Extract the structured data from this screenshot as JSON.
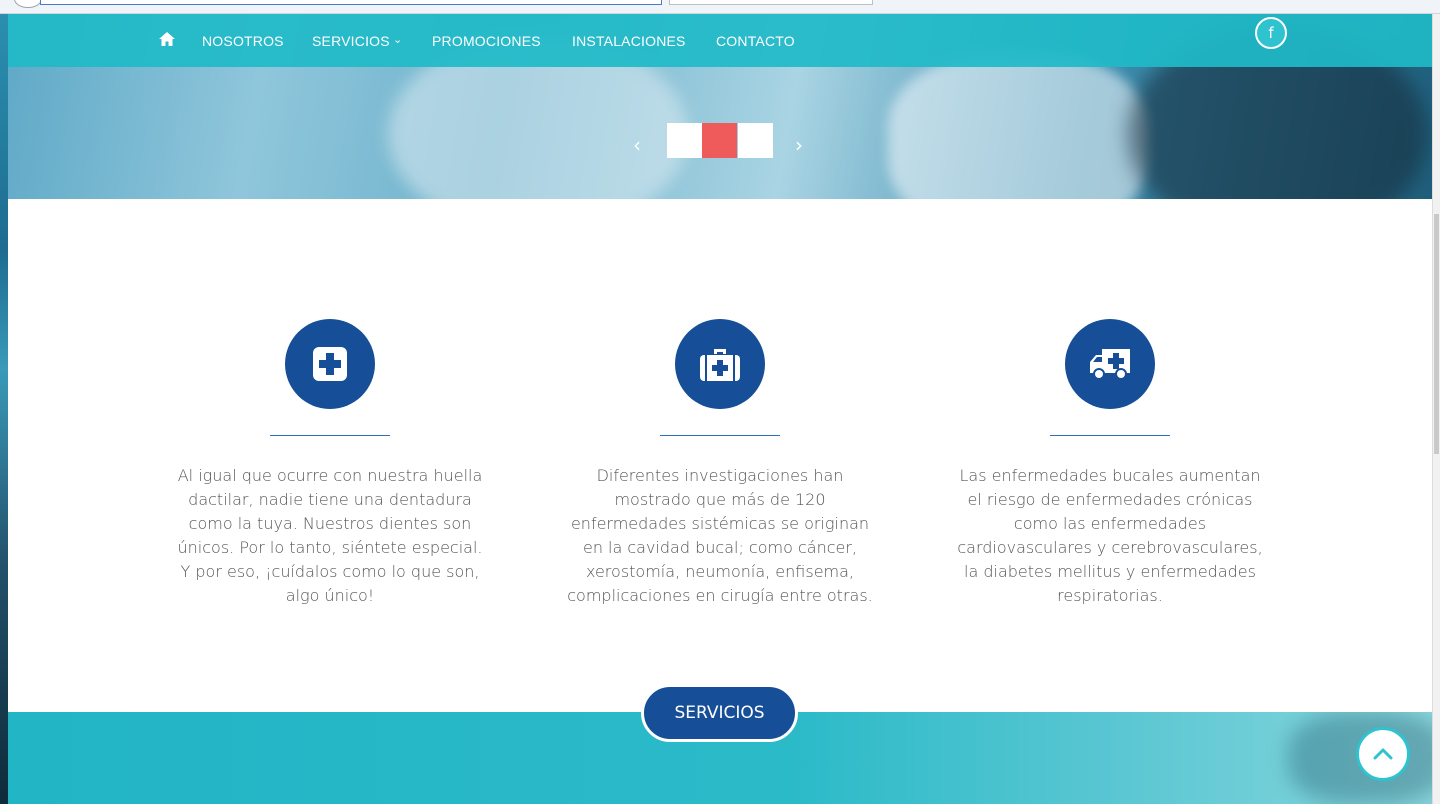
{
  "nav": {
    "items": [
      {
        "label": "NOSOTROS"
      },
      {
        "label": "SERVICIOS"
      },
      {
        "label": "PROMOCIONES"
      },
      {
        "label": "INSTALACIONES"
      },
      {
        "label": "CONTACTO"
      }
    ],
    "facebook": "f"
  },
  "slider": {
    "prev": "‹",
    "next": "›",
    "active_index": 2,
    "dot_count": 3
  },
  "features": [
    {
      "icon": "medical-cross-icon",
      "text": "Al igual que ocurre con nuestra huella dactilar, nadie tiene una dentadura como la tuya. Nuestros dientes son únicos. Por lo tanto, siéntete especial. Y por eso, ¡cuídalos como lo que son, algo único!"
    },
    {
      "icon": "first-aid-kit-icon",
      "text": "Diferentes investigaciones han mostrado que más de 120 enfermedades sistémicas se originan en la cavidad bucal; como cáncer, xerostomía, neumonía, enfisema, complicaciones en cirugía entre otras."
    },
    {
      "icon": "ambulance-icon",
      "text": "Las enfermedades bucales aumentan el riesgo de enfermedades crónicas como las enfermedades cardiovasculares y cerebrovasculares, la diabetes mellitus y enfermedades respiratorias."
    }
  ],
  "cta": {
    "label": "SERVICIOS"
  },
  "colors": {
    "nav": "#20bac8",
    "primary": "#164f97",
    "slider_active": "#ef5b5b",
    "band": "#22b5c6"
  }
}
